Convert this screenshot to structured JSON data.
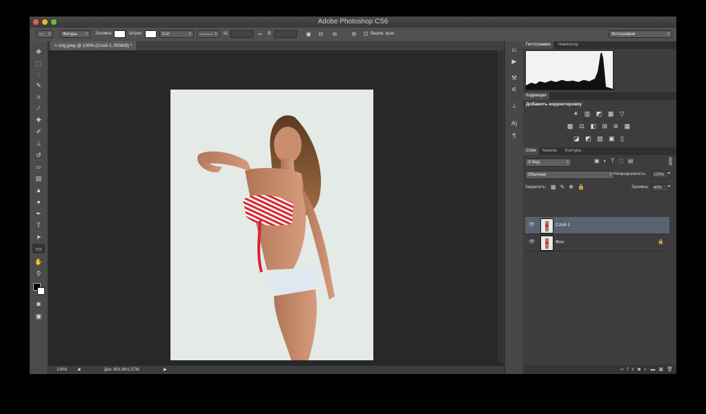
{
  "app": {
    "title": "Adobe Photoshop CS6"
  },
  "options_bar": {
    "shape_mode": "Фигуры",
    "fill_label": "Заливка:",
    "stroke_label": "Штрих:",
    "stroke_width": "3 пт",
    "width_label": "Ш:",
    "height_label": "В:",
    "align_edges": "Выров. края",
    "workspace": "Фотография"
  },
  "document": {
    "tab_title": "orig.jpeg @ 100% (Слой 1, RGB/8) *",
    "zoom": "100%",
    "doc_info": "Док: 801,6K/1,57M"
  },
  "panels": {
    "top_tabs": [
      "Гистограмма",
      "Навигатор"
    ],
    "adjust_tab": "Коррекция",
    "adjust_title": "Добавить корректировку",
    "layer_tabs": [
      "Слои",
      "Каналы",
      "Контуры"
    ],
    "filter_kind": "Вид",
    "blend_mode": "Обычные",
    "opacity_label": "Непрозрачность:",
    "opacity_value": "100%",
    "lock_label": "Закрепить:",
    "fill_label": "Заливка:",
    "fill_value": "40%",
    "layers": [
      {
        "name": "Слой 1",
        "selected": true,
        "locked": false
      },
      {
        "name": "Фон",
        "selected": false,
        "locked": true
      }
    ]
  },
  "icons": {
    "toolbox": [
      "move-icon",
      "marquee-icon",
      "lasso-icon",
      "quick-select-icon",
      "crop-icon",
      "eyedropper-icon",
      "healing-brush-icon",
      "brush-icon",
      "clone-stamp-icon",
      "history-brush-icon",
      "eraser-icon",
      "gradient-icon",
      "blur-icon",
      "dodge-icon",
      "pen-icon",
      "type-icon",
      "path-select-icon",
      "rectangle-icon",
      "hand-icon",
      "zoom-icon"
    ]
  },
  "colors": {
    "foreground": "#000000",
    "background": "#ffffff",
    "selected_layer": "#5a6272"
  }
}
